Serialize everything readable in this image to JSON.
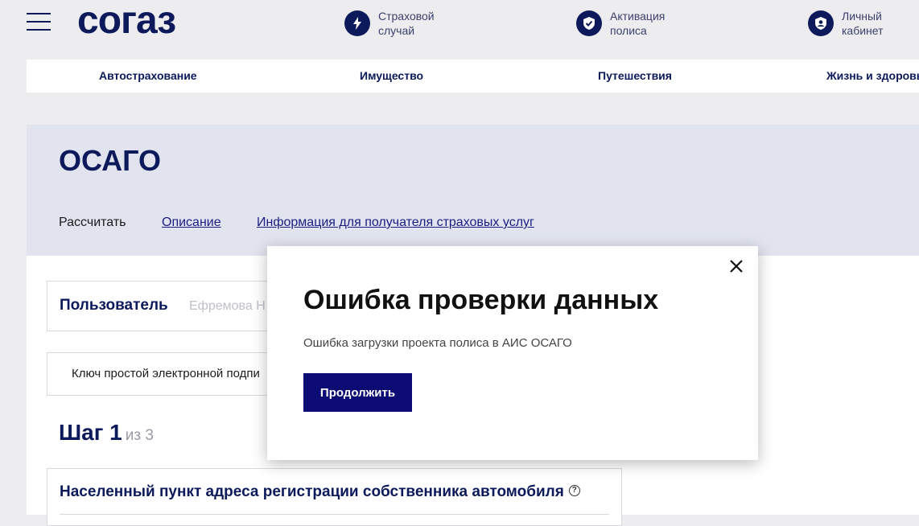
{
  "header": {
    "logo_text": "согаз",
    "actions": [
      {
        "label_line1": "Страховой",
        "label_line2": "случай",
        "icon": "lightning-shield-icon"
      },
      {
        "label_line1": "Активация",
        "label_line2": "полиса",
        "icon": "check-shield-icon"
      },
      {
        "label_line1": "Личный",
        "label_line2": "кабинет",
        "icon": "user-shield-icon"
      }
    ]
  },
  "nav": {
    "items": [
      {
        "label": "Автострахование"
      },
      {
        "label": "Имущество"
      },
      {
        "label": "Путешествия"
      },
      {
        "label": "Жизнь и здоровье"
      }
    ]
  },
  "page": {
    "title": "ОСАГО",
    "tabs": [
      {
        "label": "Рассчитать"
      },
      {
        "label": "Описание"
      },
      {
        "label": "Информация для получателя страховых услуг"
      }
    ]
  },
  "form": {
    "user_label": "Пользователь",
    "user_value": "Ефремова Н",
    "key_label": "Ключ простой электронной подпи",
    "step_label": "Шаг 1",
    "step_of": "из 3",
    "address_title": "Населенный пункт адреса регистрации собственника автомобиля"
  },
  "modal": {
    "title": "Ошибка проверки данных",
    "message": "Ошибка загрузки проекта полиса в АИС ОСАГО",
    "button_label": "Продолжить"
  },
  "colors": {
    "brand": "#0c1a5b",
    "button": "#0b0b73",
    "hero_bg": "#e1e4ef"
  }
}
